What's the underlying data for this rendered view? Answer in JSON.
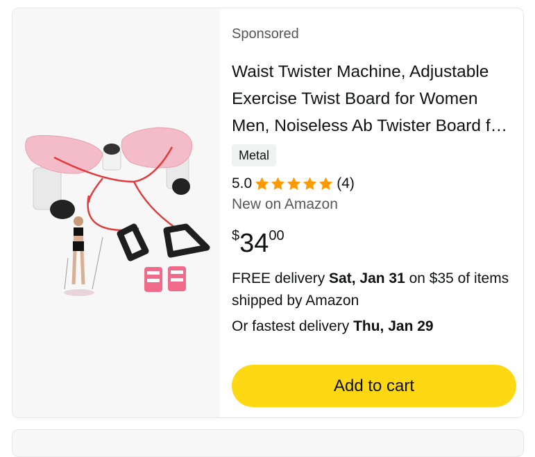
{
  "product": {
    "sponsored_label": "Sponsored",
    "title": "Waist Twister Machine, Adjustable Exercise Twist Board for Women Men, Noiseless Ab Twister Board for Home Gym Workout",
    "variant_badge": "Metal",
    "rating_value": "5.0",
    "rating_stars": 5,
    "review_count": "(4)",
    "condition": "New on Amazon",
    "price": {
      "symbol": "$",
      "whole": "34",
      "fraction": "00"
    },
    "delivery": {
      "prefix": "FREE delivery ",
      "date": "Sat, Jan 31",
      "suffix": " on $35 of items shipped by Amazon"
    },
    "fastest": {
      "prefix": "Or fastest delivery ",
      "date": "Thu, Jan 29"
    },
    "add_to_cart_label": "Add to cart"
  },
  "colors": {
    "star": "#ff9900",
    "button": "#ffd814",
    "product_pink": "#f3b8c4",
    "cord_red": "#e23a3a"
  },
  "icons": {
    "star": "star-icon"
  }
}
